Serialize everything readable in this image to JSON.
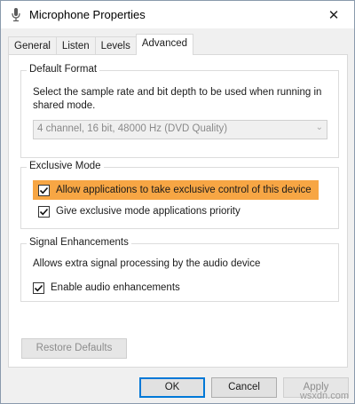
{
  "window": {
    "title": "Microphone Properties",
    "close_glyph": "✕"
  },
  "tabs": [
    {
      "label": "General"
    },
    {
      "label": "Listen"
    },
    {
      "label": "Levels"
    },
    {
      "label": "Advanced",
      "active": true
    }
  ],
  "default_format": {
    "title": "Default Format",
    "description": "Select the sample rate and bit depth to be used when running in shared mode.",
    "selected": "4 channel, 16 bit, 48000 Hz (DVD Quality)"
  },
  "exclusive_mode": {
    "title": "Exclusive Mode",
    "options": [
      {
        "label": "Allow applications to take exclusive control of this device",
        "checked": true,
        "highlighted": true
      },
      {
        "label": "Give exclusive mode applications priority",
        "checked": true
      }
    ]
  },
  "signal": {
    "title": "Signal Enhancements",
    "description": "Allows extra signal processing by the audio device",
    "option": {
      "label": "Enable audio enhancements",
      "checked": true
    }
  },
  "buttons": {
    "restore": "Restore Defaults",
    "ok": "OK",
    "cancel": "Cancel",
    "apply": "Apply"
  },
  "colors": {
    "highlight": "#f7a644",
    "accent": "#0078d7"
  },
  "watermark": "wsxdn.com"
}
